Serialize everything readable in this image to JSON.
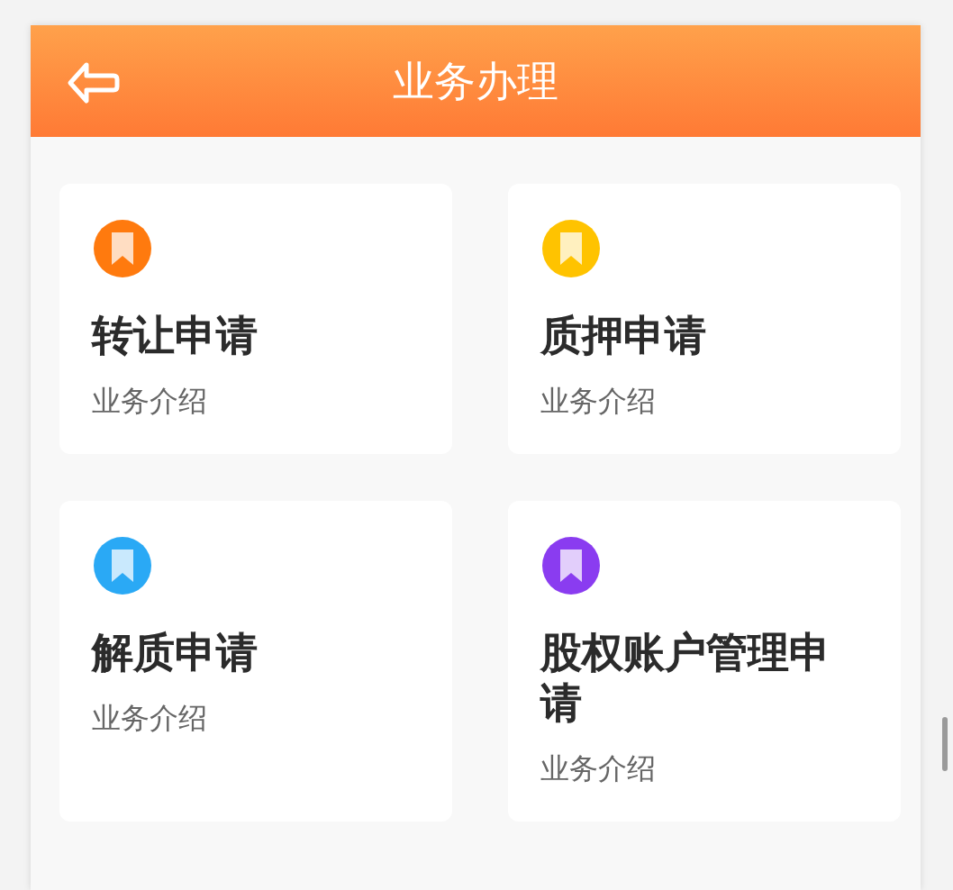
{
  "header": {
    "title": "业务办理"
  },
  "cards": [
    {
      "title": "转让申请",
      "subtitle": "业务介绍",
      "color": "#ff7a0e"
    },
    {
      "title": "质押申请",
      "subtitle": "业务介绍",
      "color": "#ffc300"
    },
    {
      "title": "解质申请",
      "subtitle": "业务介绍",
      "color": "#2aa9f5"
    },
    {
      "title": "股权账户管理申请",
      "subtitle": "业务介绍",
      "color": "#8a3cf0"
    }
  ]
}
